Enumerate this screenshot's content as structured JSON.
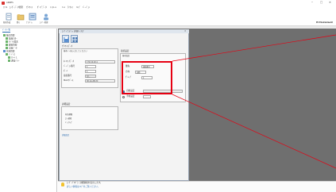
{
  "titlebar": {
    "app_title": "ANDES",
    "min": "–",
    "max": "□",
    "close": "✕"
  },
  "menu": [
    "ﾌｧｲﾙ",
    "ﾕｰｻﾞｰﾃﾞｰﾀ管理",
    "ｱﾗｲｱﾝｽ",
    "ﾀﾞﾝﾌﾟﾃﾞｰﾀ",
    "ｲﾝｽﾄｰﾙ",
    "ﾂｰﾙ",
    "ﾗｲｾﾝｽ",
    "ﾍﾙﾌﾟ",
    "ﾊﾞｰｼﾞｮﾝ"
  ],
  "toolbar": {
    "buttons": [
      "新規作成",
      "開く",
      "ﾌﾟﾛﾊﾟﾃｨ",
      "ﾕｰｻﾞｰ管理"
    ],
    "right_text": "PC Environment"
  },
  "tree": {
    "tab": "ﾃﾞｰﾀ一覧",
    "items": [
      "販売管理",
      "製品ﾏｽﾀｰ",
      "ﾓﾊﾞｲﾙ端末",
      "顧客管理",
      "出荷ﾃﾞｰﾀ",
      "在庫管理",
      "ﾃﾞﾊﾞｲｽ",
      "ｱﾗｰﾄ 1",
      "通知ﾊﾞﾅｰ"
    ]
  },
  "dialog": {
    "title": "ﾕｰｻﾞｰﾌﾟﾛﾊﾟﾃｨ 詳細ﾀﾞｲｱﾛｸﾞ",
    "left_group": {
      "header": "ｱﾗｲｱﾝｽﾃﾞｰﾀ",
      "note": "基本ﾃﾞｰﾀを入力してください",
      "rows": [
        {
          "label": "ﾈｯﾄﾜｰｸﾃﾞｰﾀ",
          "value": "172.16.10.1"
        },
        {
          "label": "ﾊﾞｰｼﾞｮﾝ番号",
          "value": "1"
        },
        {
          "label": "ﾎﾟｰﾄ",
          "value": "1"
        },
        {
          "label": "接続番号",
          "value": "なし"
        },
        {
          "label": "MACｱﾄﾞﾚｽ",
          "value": "00-1A-2B-3C"
        }
      ]
    },
    "right_group": {
      "header": "接続設定",
      "sub": "基本設定",
      "fields": [
        {
          "label": "優先",
          "value": "接続番号"
        },
        {
          "label": "方向",
          "value": "自動"
        },
        {
          "label": "ｸﾞﾙｰﾌﾟ",
          "value": "1"
        }
      ],
      "radio1": "自動設定",
      "radio2": "手動設定"
    },
    "bottom_group": {
      "header": "詳細設定",
      "rows": [
        "有効期限",
        "ｴﾗｰ通知",
        "ﾊﾞｯｸｱｯﾌﾟ"
      ]
    },
    "link": "詳細設定"
  },
  "infobar": {
    "line1": "ﾕｰｻﾞｰﾌﾟﾛﾊﾟﾃｨ 詳細情報を表示します。",
    "line2": "詳しい情報はﾍﾙﾌﾟをご覧ください。"
  },
  "colors": {
    "callout": "#e60012",
    "canvas": "#6f6f6f",
    "accent": "#2b6cb0"
  }
}
